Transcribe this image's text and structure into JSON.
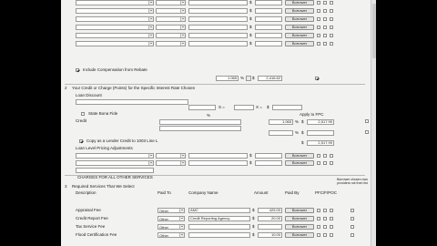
{
  "compensation": {
    "currency": "$",
    "borrower_label": "Borrower",
    "rows": [
      {},
      {},
      {},
      {},
      {},
      {}
    ]
  },
  "rebate": {
    "label": "Include Compensation from Rebate"
  },
  "credit_section": {
    "number": "2",
    "title": "Your Credit or Charge (Points) for the Specific Interest Rate Chosen",
    "loan_discount_label": "Loan Discount",
    "state_bona_fide_label": "State Bona Fide",
    "credit_label": "Credit",
    "rate_value": "1.065",
    "pct": "%",
    "amount_value": "2,416.62",
    "operator_s": "S =",
    "operator_x": "X =",
    "currency": "$",
    "apply_label": "Apply to FPC",
    "credit_pct": "1.065",
    "credit_amount": "2,517.99",
    "copy_lender_label": "Copy as a Lender Credit to 1003 Line L",
    "credit_amount_2": "2,517.99",
    "pricing_label": "Loan Level Pricing Adjustments",
    "borrower_label": "Borrower"
  },
  "charges_header": {
    "title": "CHARGES FOR ALL OTHER SERVICES",
    "note": "Borrower chosen own providers not from list"
  },
  "required": {
    "number": "3",
    "title": "Required Services That We Select",
    "col_description": "Description",
    "col_paid_to": "Paid To",
    "col_company": "Company Name",
    "col_amount": "Amount",
    "col_paid_by": "Paid By",
    "col_flags": "PFC/F/POC",
    "currency": "$",
    "rows": [
      {
        "description": "Appraisal Fee",
        "paid_to": "Other",
        "company": "AMC",
        "amount": "425.00",
        "paid_by": "Borrower"
      },
      {
        "description": "Credit Report Fee",
        "paid_to": "Other",
        "company": "Credit Reporting Agency",
        "amount": "20.00",
        "paid_by": "Borrower"
      },
      {
        "description": "Tax Service Fee",
        "paid_to": "Other",
        "company": "",
        "amount": "",
        "paid_by": "Borrower"
      },
      {
        "description": "Flood Certification Fee",
        "paid_to": "Other",
        "company": "",
        "amount": "10.00",
        "paid_by": "Borrower"
      }
    ]
  }
}
